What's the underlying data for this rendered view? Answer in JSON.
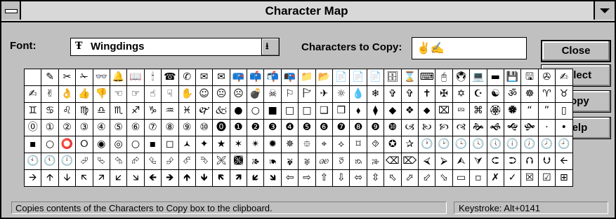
{
  "window": {
    "title": "Character Map"
  },
  "font": {
    "label": "Font:",
    "value": "Wingdings",
    "tt_glyph": "Ŧ"
  },
  "copy": {
    "label": "Characters to Copy:",
    "value": "✌✍"
  },
  "buttons": {
    "close": "Close",
    "select": "Select",
    "copy": "Copy",
    "help": "Help"
  },
  "grid": {
    "rows": [
      [
        " ",
        "✎",
        "✂",
        "✁",
        "👓",
        "🔔",
        "📖",
        "🕯",
        "☎",
        "✆",
        "✉",
        "✉",
        "📪",
        "📫",
        "📬",
        "📭",
        "📁",
        "📂",
        "📄",
        "📄",
        "📄",
        "🗄",
        "⌛",
        "⌨",
        "🖰",
        "🖲",
        "💻",
        "▬",
        "💾",
        "🖫",
        "✇",
        "✍"
      ],
      [
        "✍",
        "✌",
        "👌",
        "👍",
        "👎",
        "☜",
        "☞",
        "☝",
        "☟",
        "✋",
        "☺",
        "😐",
        "☹",
        "💣",
        "☠",
        "⚐",
        "🏱",
        "✈",
        "☼",
        "💧",
        "❄",
        "✞",
        "✞",
        "✝",
        "✠",
        "✡",
        "☪",
        "☯",
        "ॐ",
        "☸",
        "♈",
        "♉"
      ],
      [
        "♊",
        "♋",
        "♌",
        "♍",
        "♎",
        "♏",
        "♐",
        "♑",
        "♒",
        "♓",
        "🙰",
        "🙵",
        "●",
        "○",
        "■",
        "□",
        "□",
        "❑",
        "❒",
        "⬧",
        "⧫",
        "◆",
        "❖",
        "⬥",
        "⌧",
        "⮹",
        "⌘",
        "🏵",
        "🏶",
        "“",
        "”",
        "▯"
      ],
      [
        "⓪",
        "①",
        "②",
        "③",
        "④",
        "⑤",
        "⑥",
        "⑦",
        "⑧",
        "⑨",
        "⑩",
        "⓿",
        "❶",
        "❷",
        "❸",
        "❹",
        "❺",
        "❻",
        "❼",
        "❽",
        "❾",
        "❿",
        "🙢",
        "🙠",
        "🙡",
        "🙣",
        "🙞",
        "🙜",
        "🙝",
        "🙟",
        "·",
        "•"
      ],
      [
        "▪",
        "○",
        "⭕",
        "⭘",
        "◉",
        "◎",
        "○",
        "▪",
        "◻",
        "🟁",
        "✦",
        "★",
        "✶",
        "✴",
        "✹",
        "✵",
        "⯐",
        "⌖",
        "⟡",
        "⌑",
        "⯑",
        "✪",
        "✰",
        "🕐",
        "🕑",
        "🕒",
        "🕓",
        "🕔",
        "🕕",
        "🕖",
        "🕗",
        "🕘"
      ],
      [
        "🕙",
        "🕚",
        "🕛",
        "⮰",
        "⮱",
        "⮲",
        "⮳",
        "⮴",
        "⮵",
        "⮶",
        "⮷",
        "🙪",
        "🙫",
        "🙕",
        "🙔",
        "🙗",
        "🙖",
        "🙐",
        "🙑",
        "🙒",
        "🙓",
        "⌫",
        "⌦",
        "⮘",
        "⮚",
        "⮙",
        "⮛",
        "⮈",
        "⮊",
        "⮉",
        "⮋",
        "🡨"
      ],
      [
        "🡪",
        "🡩",
        "🡫",
        "🡬",
        "🡭",
        "🡯",
        "🡮",
        "🡸",
        "🡺",
        "🡹",
        "🡻",
        "🡼",
        "🡽",
        "🡿",
        "🡾",
        "⇦",
        "⇨",
        "⇧",
        "⇩",
        "⬄",
        "⇳",
        "⬁",
        "⬀",
        "⬃",
        "⬂",
        "▭",
        "▫",
        "✗",
        "✓",
        "☒",
        "☑",
        "⊞"
      ]
    ]
  },
  "status": {
    "message": "Copies contents of the Characters to Copy box to the clipboard.",
    "keystroke": "Keystroke: Alt+0141"
  }
}
